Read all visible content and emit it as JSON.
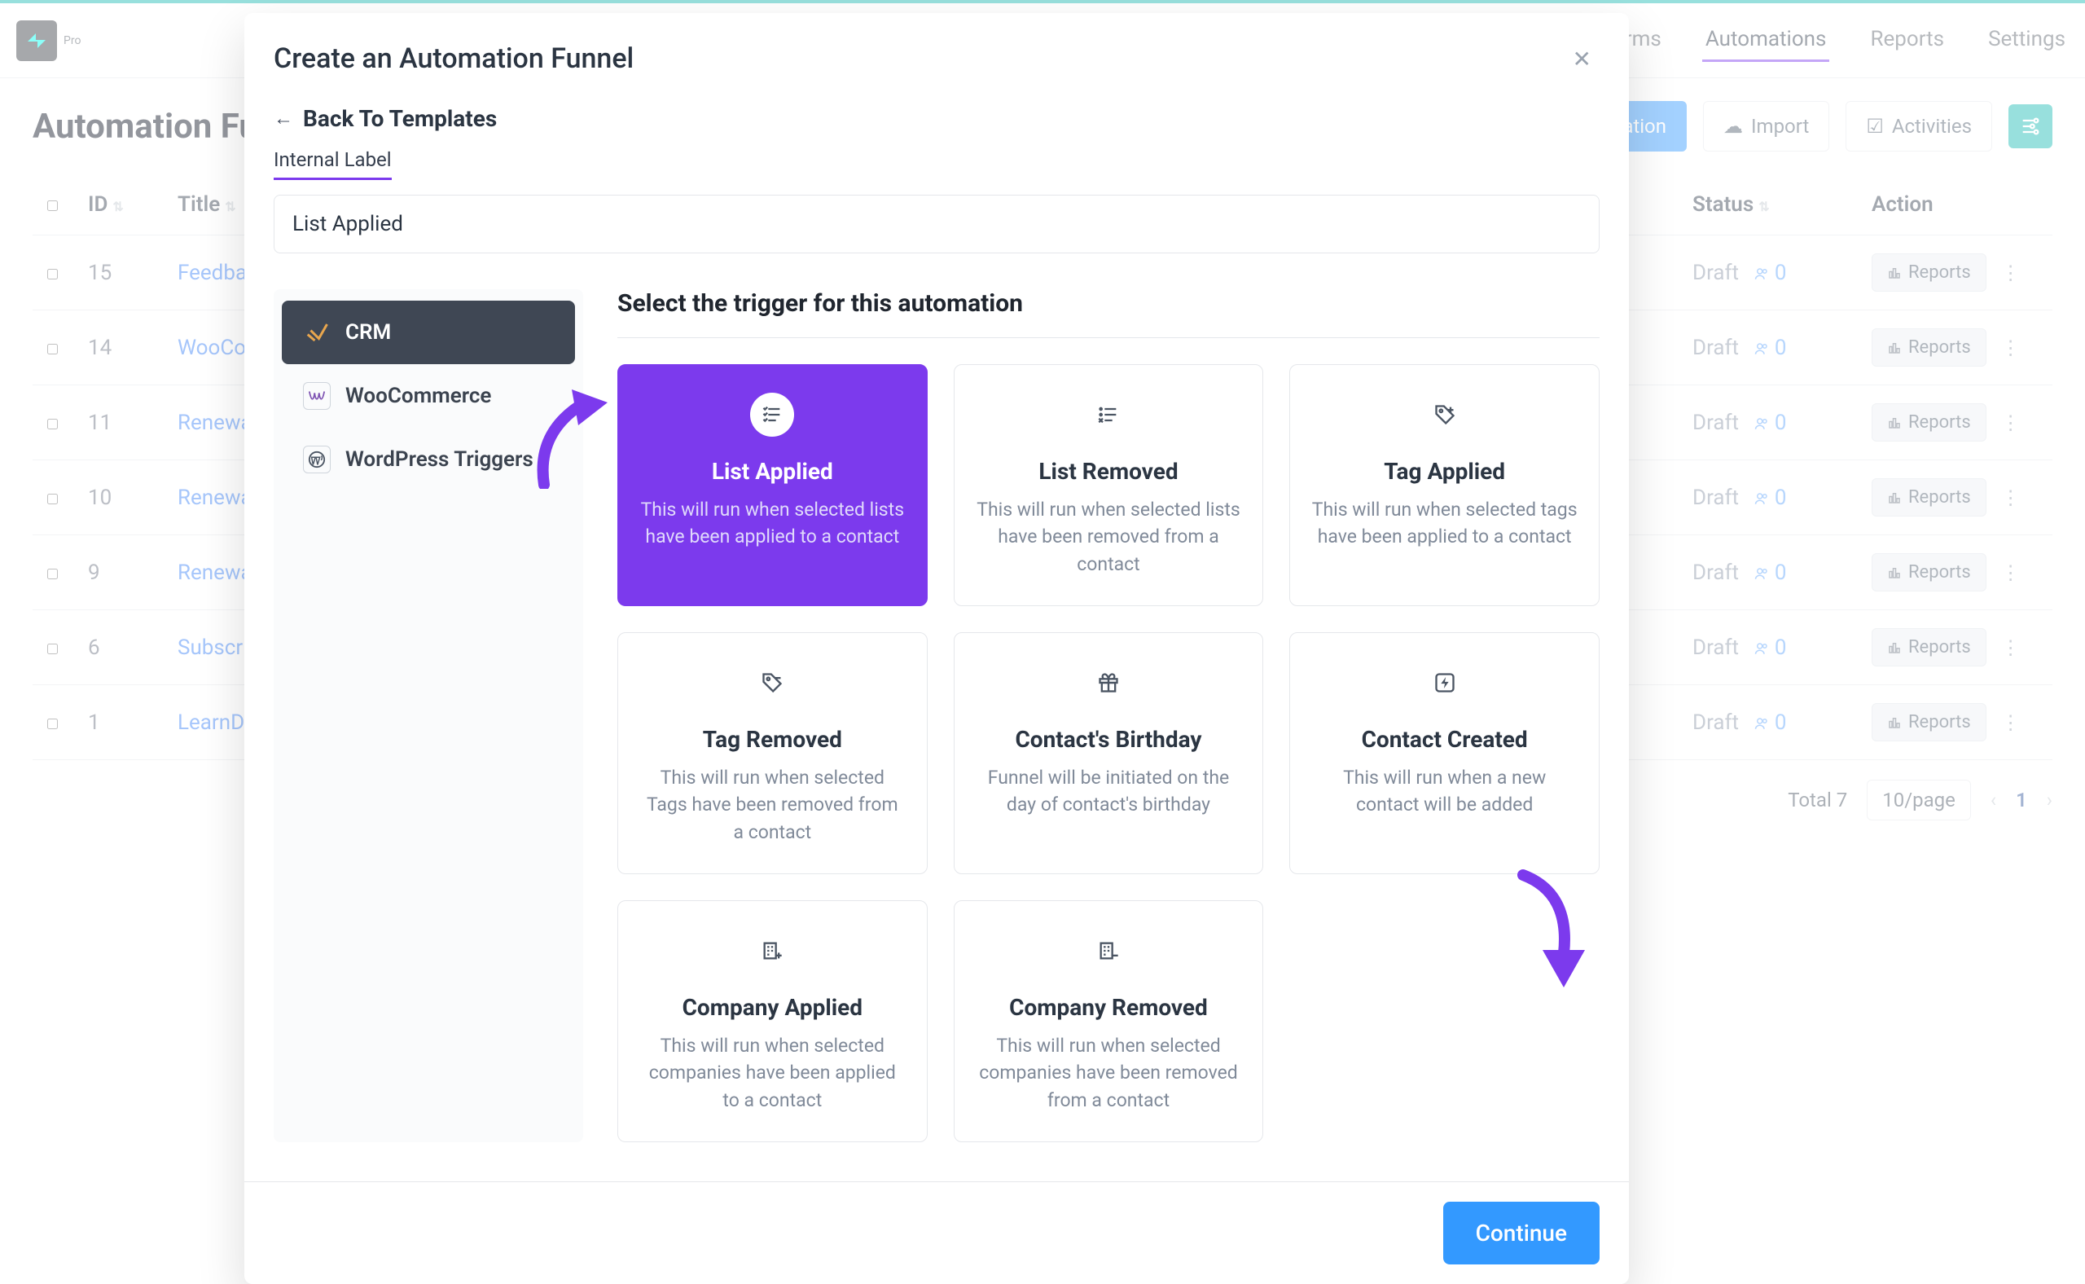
{
  "brand": {
    "pro": "Pro"
  },
  "nav": {
    "tabs": [
      "…rms",
      "Automations",
      "Reports",
      "Settings"
    ],
    "active": 1
  },
  "page": {
    "title": "Automation Funne…"
  },
  "actions": {
    "new_automation": "Automation",
    "import": "Import",
    "activities": "Activities"
  },
  "table": {
    "headers": {
      "id": "ID",
      "title": "Title",
      "status": "Status",
      "action": "Action"
    },
    "reports_label": "Reports",
    "rows": [
      {
        "id": "15",
        "title": "Feedback",
        "status": "Draft",
        "count": "0"
      },
      {
        "id": "14",
        "title": "WooCom…",
        "status": "Draft",
        "count": "0"
      },
      {
        "id": "11",
        "title": "Renewal P…",
        "status": "Draft",
        "count": "0"
      },
      {
        "id": "10",
        "title": "Renewal P…",
        "status": "Draft",
        "count": "0"
      },
      {
        "id": "9",
        "title": "Renewal S…",
        "status": "Draft",
        "count": "0"
      },
      {
        "id": "6",
        "title": "Subscripti…",
        "status": "Draft",
        "count": "0"
      },
      {
        "id": "1",
        "title": "LearnDas…",
        "status": "Draft",
        "count": "0"
      }
    ],
    "footer": {
      "total": "Total 7",
      "per_page": "10/page",
      "current": "1"
    }
  },
  "modal": {
    "title": "Create an Automation Funnel",
    "back": "Back To Templates",
    "label_caption": "Internal Label",
    "label_value": "List Applied",
    "trigger_heading": "Select the trigger for this automation",
    "categories": [
      {
        "key": "crm",
        "label": "CRM",
        "active": true,
        "icon": "check-stroke"
      },
      {
        "key": "woo",
        "label": "WooCommerce",
        "active": false,
        "icon": "box"
      },
      {
        "key": "wp",
        "label": "WordPress Triggers",
        "active": false,
        "icon": "wp"
      }
    ],
    "triggers": [
      {
        "key": "list-applied",
        "title": "List Applied",
        "desc": "This will run when selected lists have been applied to a contact",
        "selected": true,
        "icon": "list-check"
      },
      {
        "key": "list-removed",
        "title": "List Removed",
        "desc": "This will run when selected lists have been removed from a contact",
        "icon": "list-x"
      },
      {
        "key": "tag-applied",
        "title": "Tag Applied",
        "desc": "This will run when selected tags have been applied to a contact",
        "icon": "tag-plus"
      },
      {
        "key": "tag-removed",
        "title": "Tag Removed",
        "desc": "This will run when selected Tags have been removed from a contact",
        "icon": "tag-minus"
      },
      {
        "key": "contact-birthday",
        "title": "Contact's Birthday",
        "desc": "Funnel will be initiated on the day of contact's birthday",
        "icon": "gift"
      },
      {
        "key": "contact-created",
        "title": "Contact Created",
        "desc": "This will run when a new contact will be added",
        "icon": "bolt"
      },
      {
        "key": "company-applied",
        "title": "Company Applied",
        "desc": "This will run when selected companies have been applied to a contact",
        "icon": "company-plus"
      },
      {
        "key": "company-removed",
        "title": "Company Removed",
        "desc": "This will run when selected companies have been removed from a contact",
        "icon": "company-minus"
      }
    ],
    "continue": "Continue"
  }
}
